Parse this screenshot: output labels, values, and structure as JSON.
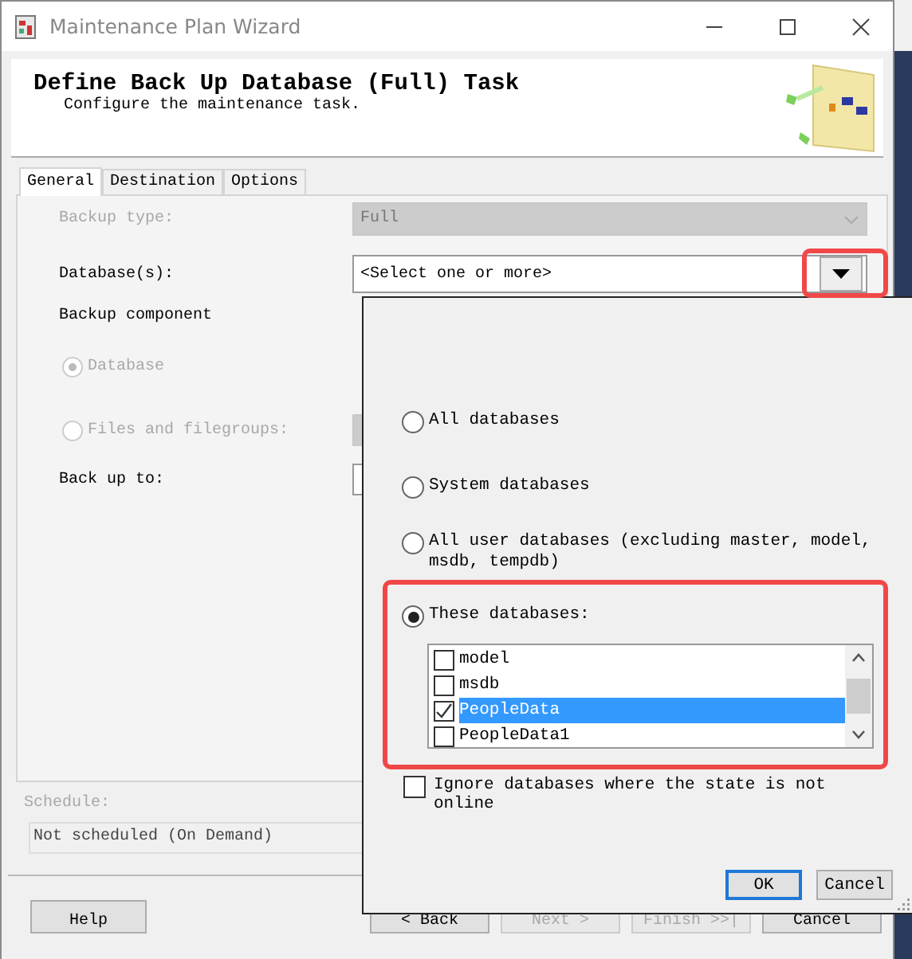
{
  "window": {
    "title": "Maintenance Plan Wizard"
  },
  "header": {
    "title": "Define Back Up Database (Full) Task",
    "subtitle": "Configure the maintenance task."
  },
  "tabs": [
    {
      "label": "General",
      "selected": true
    },
    {
      "label": "Destination",
      "selected": false
    },
    {
      "label": "Options",
      "selected": false
    }
  ],
  "form": {
    "backup_type": {
      "label": "Backup type:",
      "value": "Full",
      "disabled": true
    },
    "databases": {
      "label": "Database(s):",
      "value": "<Select one or more>"
    },
    "backup_component": {
      "label": "Backup component",
      "options": [
        {
          "label": "Database",
          "selected": true,
          "disabled": true
        },
        {
          "label": "Files and filegroups:",
          "selected": false,
          "disabled": true
        }
      ]
    },
    "back_up_to": {
      "label": "Back up to:"
    }
  },
  "schedule": {
    "label": "Schedule:",
    "value": "Not scheduled (On Demand)"
  },
  "buttons": [
    {
      "label": "Help",
      "disabled": false
    },
    {
      "label": "< Back",
      "disabled": false
    },
    {
      "label": "Next >",
      "disabled": true
    },
    {
      "label": "Finish >>|",
      "disabled": true
    },
    {
      "label": "Cancel",
      "disabled": false
    }
  ],
  "popup": {
    "options": [
      {
        "label": "All databases",
        "selected": false
      },
      {
        "label": "System databases",
        "selected": false
      },
      {
        "label": "All user databases  (excluding master, model, msdb, tempdb)",
        "selected": false
      },
      {
        "label": "These databases:",
        "selected": true
      }
    ],
    "databases": [
      {
        "name": "model",
        "checked": false,
        "selected": false
      },
      {
        "name": "msdb",
        "checked": false,
        "selected": false
      },
      {
        "name": "PeopleData",
        "checked": true,
        "selected": true
      },
      {
        "name": "PeopleData1",
        "checked": false,
        "selected": false
      }
    ],
    "ignore_offline": {
      "label": "Ignore databases where the state is not online",
      "checked": false
    },
    "buttons": [
      {
        "label": "OK",
        "default": true
      },
      {
        "label": "Cancel",
        "default": false
      }
    ]
  }
}
